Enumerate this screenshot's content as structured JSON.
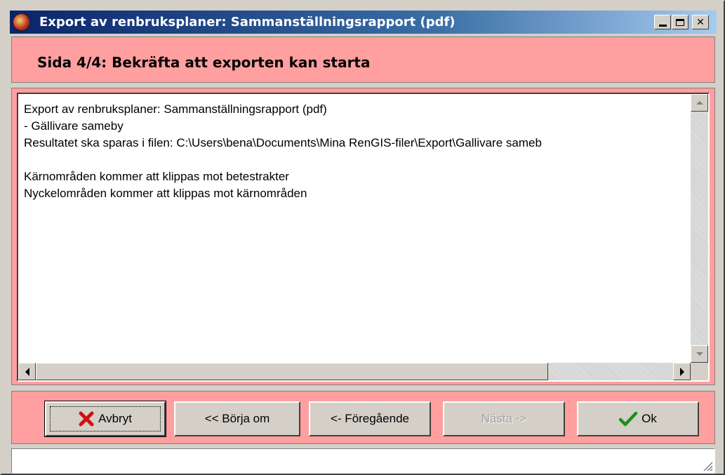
{
  "window": {
    "title": "Export av renbruksplaner: Sammanställningsrapport (pdf)",
    "icon": "app-icon"
  },
  "header": {
    "title": "Sida 4/4: Bekräfta att exporten kan starta"
  },
  "summary": {
    "lines": [
      "Export av renbruksplaner: Sammanställningsrapport (pdf)",
      "- Gällivare sameby",
      "Resultatet ska sparas i filen: C:\\Users\\bena\\Documents\\Mina RenGIS-filer\\Export\\Gallivare sameb",
      "",
      "Kärnområden kommer att klippas mot betestrakter",
      "Nyckelområden kommer att klippas mot kärnområden"
    ]
  },
  "buttons": {
    "cancel": "Avbryt",
    "restart": "<< Börja om",
    "previous": "<- Föregående",
    "next": "Nästa ->",
    "ok": "Ok"
  },
  "status": {
    "text": ""
  },
  "colors": {
    "panel_bg": "#ff9f9f",
    "dialog_bg": "#d4d0c8",
    "titlebar": "#0a246a",
    "cancel_icon": "#cc1111",
    "ok_icon": "#1a8f1a"
  }
}
